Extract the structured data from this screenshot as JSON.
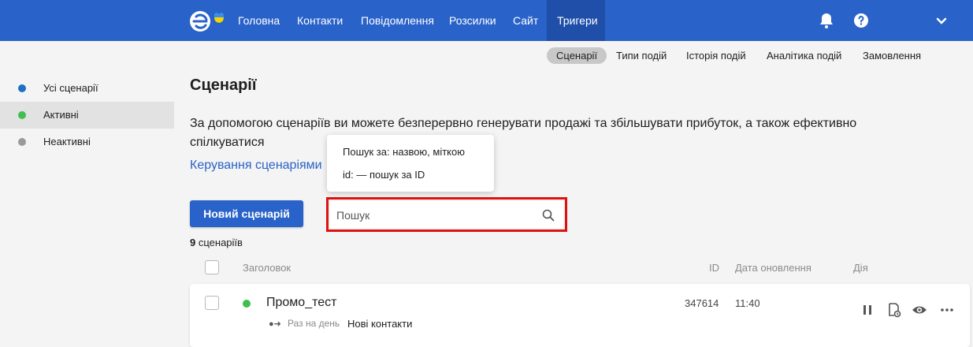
{
  "nav": {
    "items": [
      {
        "label": "Головна"
      },
      {
        "label": "Контакти"
      },
      {
        "label": "Повідомлення"
      },
      {
        "label": "Розсилки"
      },
      {
        "label": "Сайт"
      },
      {
        "label": "Тригери",
        "active": true
      }
    ],
    "icons": [
      "bell-icon",
      "help-icon",
      "chevron-down-icon"
    ],
    "bar_color": "#2962c9"
  },
  "subnav": {
    "items": [
      {
        "label": "Сценарії",
        "active": true
      },
      {
        "label": "Типи подій"
      },
      {
        "label": "Історія подій"
      },
      {
        "label": "Аналітика подій"
      },
      {
        "label": "Замовлення"
      }
    ]
  },
  "sidebar": {
    "items": [
      {
        "label": "Усі сценарії",
        "color": "#1f6fc4"
      },
      {
        "label": "Активні",
        "color": "#3fbf4f",
        "active": true
      },
      {
        "label": "Неактивні",
        "color": "#9a9a9a"
      }
    ]
  },
  "main": {
    "title": "Сценарії",
    "description": "За допомогою сценаріїв ви можете безперервно генерувати продажі та збільшувати прибуток, а також ефективно спілкуватися",
    "manage_link": "Керування сценаріями",
    "new_button": "Новий сценарій",
    "search": {
      "placeholder": "Пошук",
      "tooltip_line1": "Пошук за: назвою, міткою",
      "tooltip_line2": "id: — пошук за ID"
    },
    "count_number": "9",
    "count_label": "сценаріїв"
  },
  "table": {
    "headers": {
      "title": "Заголовок",
      "id": "ID",
      "updated": "Дата оновлення",
      "action": "Дія"
    },
    "rows": [
      {
        "name": "Промо_тест",
        "status_color": "#3fbf4f",
        "frequency": "Раз на день",
        "trigger": "Нові контакти",
        "id": "347614",
        "updated": "11:40",
        "actions": [
          "pause-icon",
          "copy-icon",
          "view-icon",
          "more-icon"
        ]
      }
    ]
  }
}
